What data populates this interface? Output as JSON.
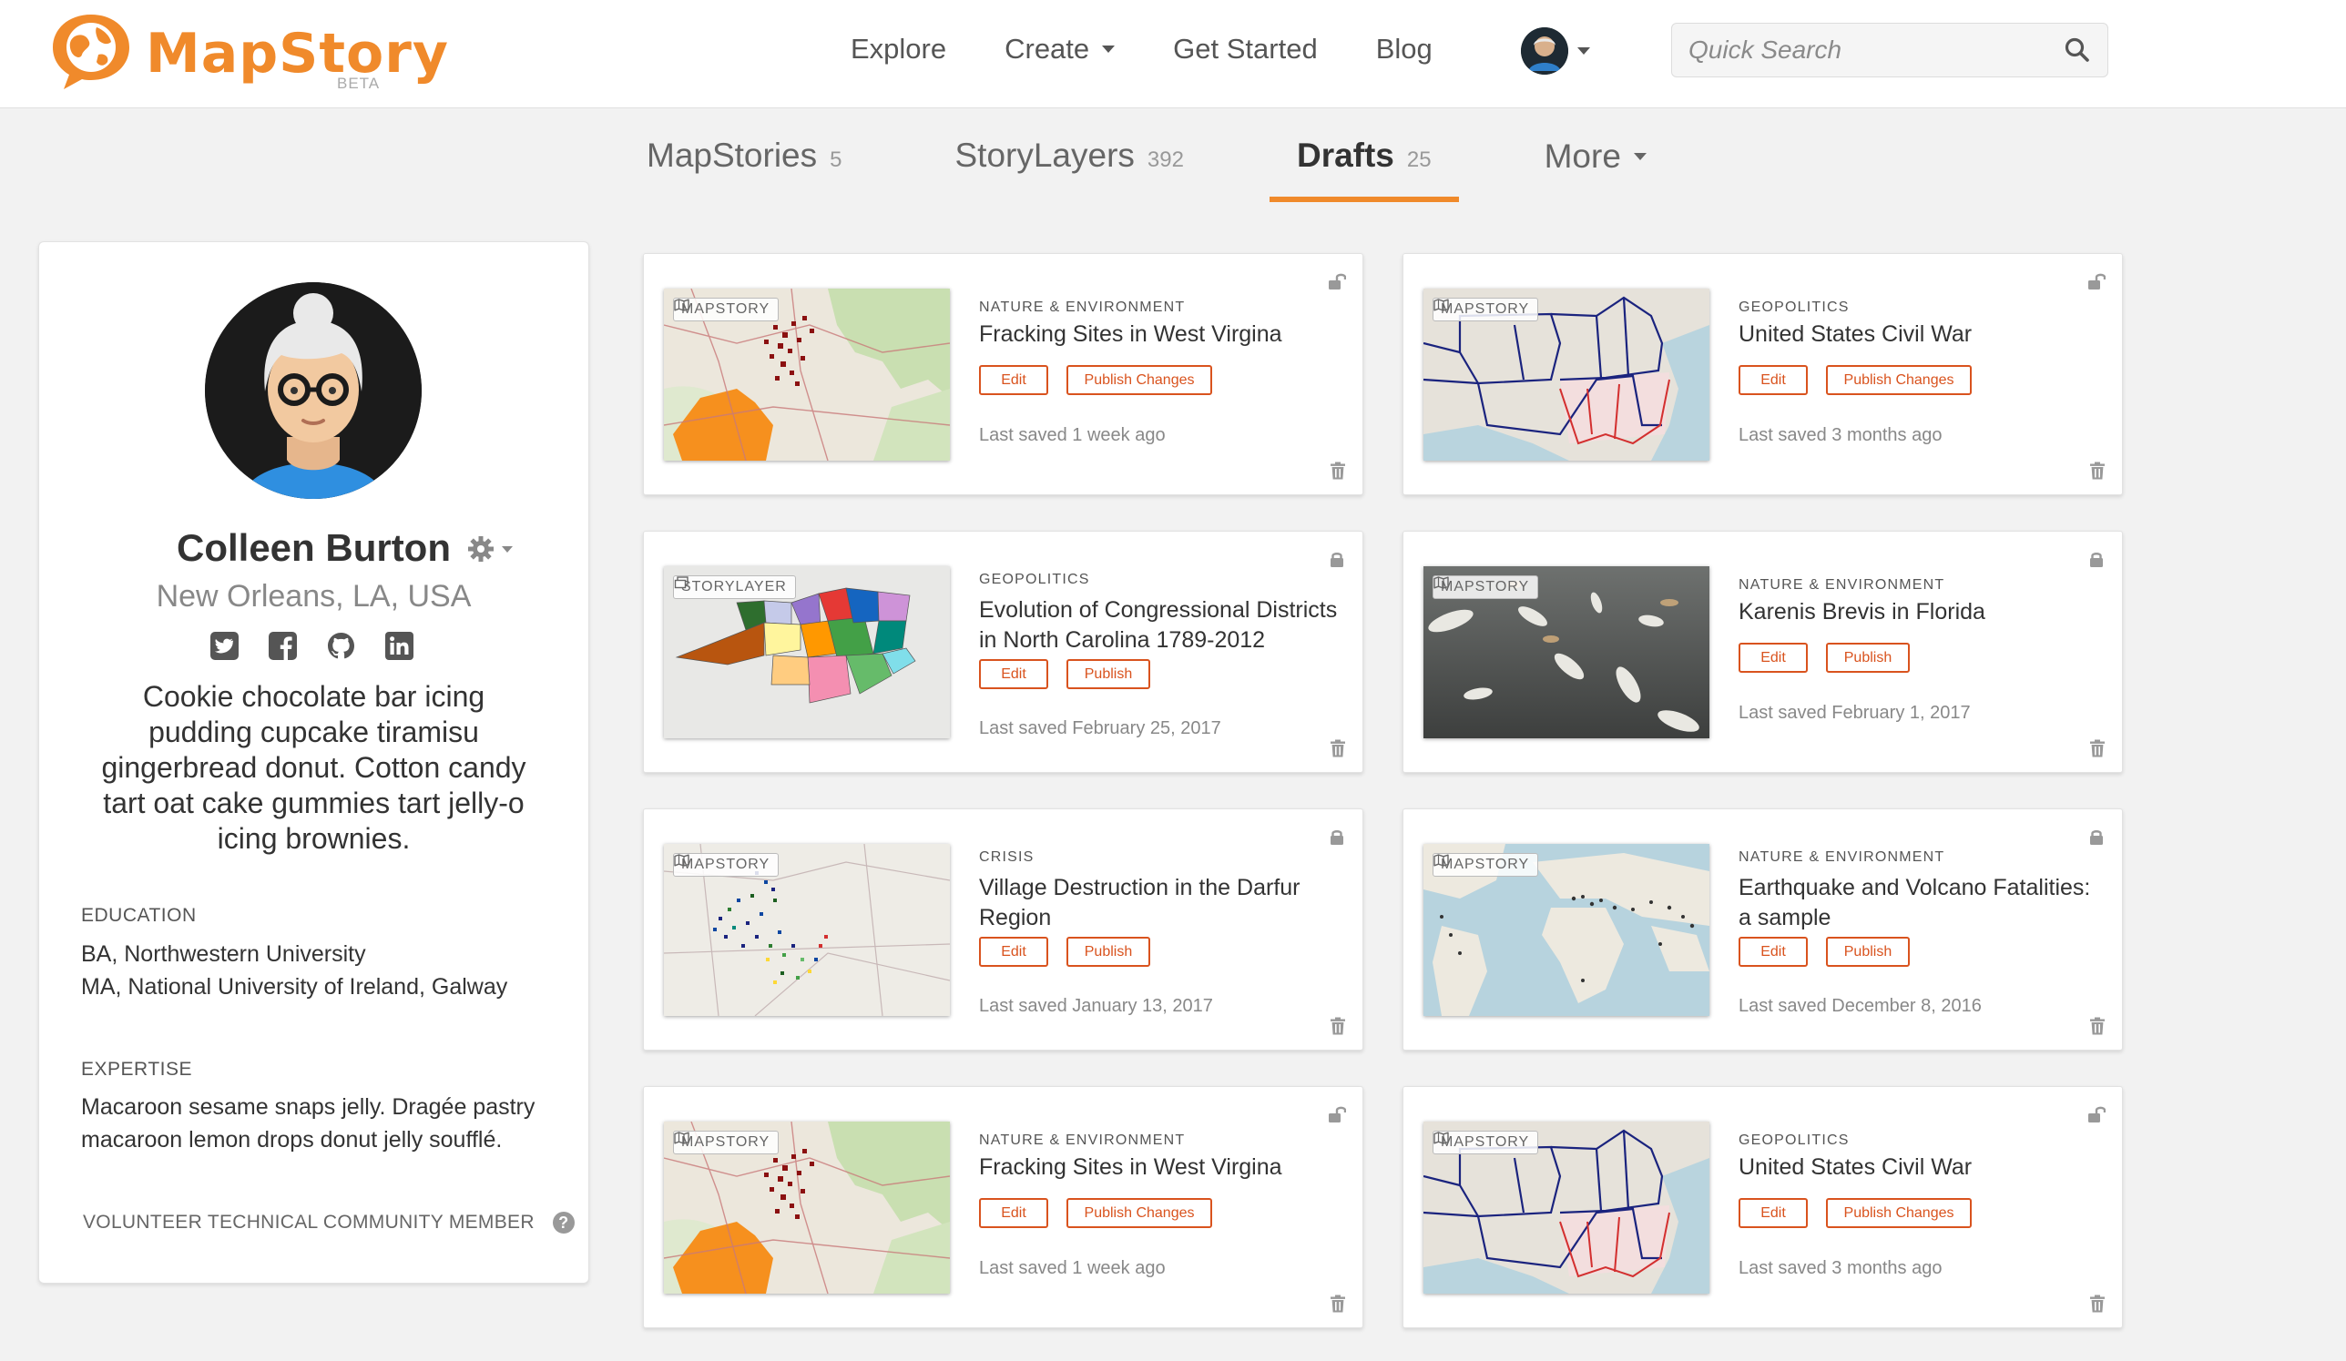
{
  "header": {
    "logo_text": "MapStory",
    "logo_sub": "BETA",
    "nav": [
      "Explore",
      "Create",
      "Get Started",
      "Blog"
    ],
    "search_placeholder": "Quick Search"
  },
  "tabs": [
    {
      "label": "MapStories",
      "count": "5"
    },
    {
      "label": "StoryLayers",
      "count": "392"
    },
    {
      "label": "Drafts",
      "count": "25"
    },
    {
      "label": "More",
      "count": ""
    }
  ],
  "profile": {
    "name": "Colleen Burton",
    "location": "New Orleans, LA, USA",
    "bio": "Cookie chocolate bar icing pudding cupcake tiramisu gingerbread donut. Cotton candy tart oat cake gummies tart jelly-o icing brownies.",
    "education_label": "EDUCATION",
    "education": [
      "BA, Northwestern University",
      "MA, National University of Ireland, Galway"
    ],
    "expertise_label": "EXPERTISE",
    "expertise": "Macaroon sesame snaps jelly. Dragée pastry macaroon lemon drops donut jelly soufflé.",
    "volunteer": "VOLUNTEER TECHNICAL COMMUNITY MEMBER"
  },
  "cards": [
    {
      "badge": "MAPSTORY",
      "category": "NATURE & ENVIRONMENT",
      "title": "Fracking Sites in West Virgina",
      "edit": "Edit",
      "publish": "Publish Changes",
      "saved": "Last saved 1 week ago",
      "lock": "unlocked",
      "thumb": "wv"
    },
    {
      "badge": "MAPSTORY",
      "category": "GEOPOLITICS",
      "title": "United States Civil War",
      "edit": "Edit",
      "publish": "Publish Changes",
      "saved": "Last saved 3 months ago",
      "lock": "unlocked",
      "thumb": "us"
    },
    {
      "badge": "STORYLAYER",
      "category": "GEOPOLITICS",
      "title": "Evolution of Congressional Districts in North Carolina 1789-2012",
      "edit": "Edit",
      "publish": "Publish",
      "saved": "Last saved February 25, 2017",
      "lock": "locked",
      "thumb": "nc"
    },
    {
      "badge": "MAPSTORY",
      "category": "NATURE & ENVIRONMENT",
      "title": "Karenis Brevis in Florida",
      "edit": "Edit",
      "publish": "Publish",
      "saved": "Last saved February 1, 2017",
      "lock": "locked",
      "thumb": "fish"
    },
    {
      "badge": "MAPSTORY",
      "category": "CRISIS",
      "title": "Village Destruction in the Darfur Region",
      "edit": "Edit",
      "publish": "Publish",
      "saved": "Last saved January 13, 2017",
      "lock": "locked",
      "thumb": "darfur"
    },
    {
      "badge": "MAPSTORY",
      "category": "NATURE & ENVIRONMENT",
      "title": "Earthquake and Volcano Fatalities: a sample",
      "edit": "Edit",
      "publish": "Publish",
      "saved": "Last saved December 8, 2016",
      "lock": "locked",
      "thumb": "world"
    },
    {
      "badge": "MAPSTORY",
      "category": "NATURE & ENVIRONMENT",
      "title": "Fracking Sites in West Virgina",
      "edit": "Edit",
      "publish": "Publish Changes",
      "saved": "Last saved 1 week ago",
      "lock": "unlocked",
      "thumb": "wv"
    },
    {
      "badge": "MAPSTORY",
      "category": "GEOPOLITICS",
      "title": "United States Civil War",
      "edit": "Edit",
      "publish": "Publish Changes",
      "saved": "Last saved 3 months ago",
      "lock": "unlocked",
      "thumb": "us"
    }
  ]
}
